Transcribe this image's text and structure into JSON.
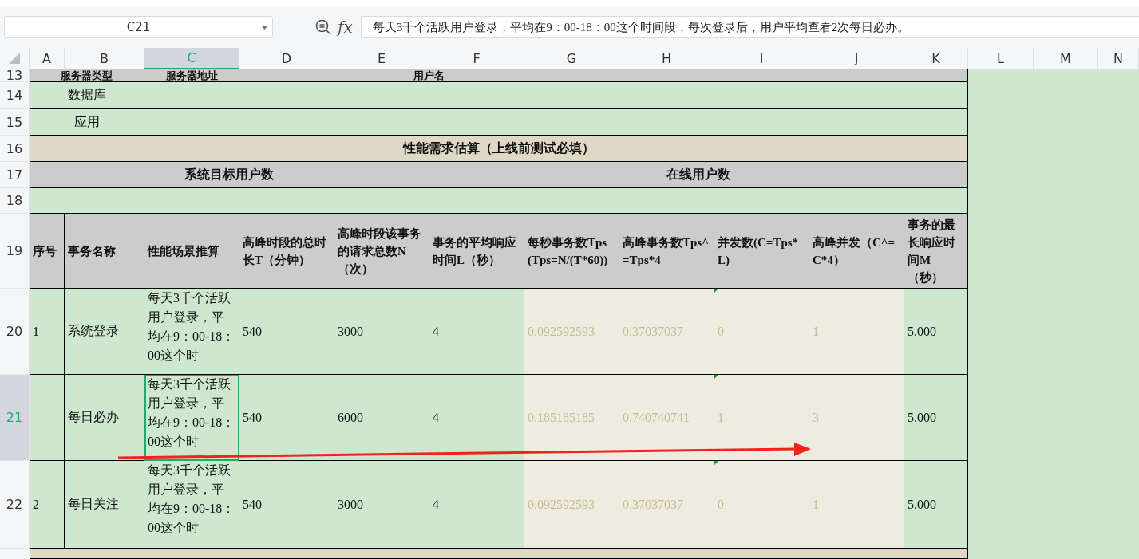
{
  "formula_bar": {
    "name_box": "C21",
    "function_label": "fx",
    "formula": "每天3千个活跃用户登录，平均在9：00-18：00这个时间段，每次登录后，用户平均查看2次每日必办。"
  },
  "column_headers": [
    {
      "label": "A",
      "selected": false
    },
    {
      "label": "B",
      "selected": false
    },
    {
      "label": "C",
      "selected": true
    },
    {
      "label": "D",
      "selected": false
    },
    {
      "label": "E",
      "selected": false
    },
    {
      "label": "F",
      "selected": false
    },
    {
      "label": "G",
      "selected": false
    },
    {
      "label": "H",
      "selected": false
    },
    {
      "label": "I",
      "selected": false
    },
    {
      "label": "J",
      "selected": false
    },
    {
      "label": "K",
      "selected": false
    },
    {
      "label": "L",
      "selected": false
    },
    {
      "label": "M",
      "selected": false
    },
    {
      "label": "N",
      "selected": false
    }
  ],
  "rows": [
    {
      "number": "13",
      "selected": false,
      "kind": "server_header",
      "cells": [
        "服务器类型",
        "服务器地址",
        "用户名"
      ]
    },
    {
      "number": "14",
      "selected": false,
      "kind": "server",
      "cells": [
        "数据库"
      ]
    },
    {
      "number": "15",
      "selected": false,
      "kind": "server",
      "cells": [
        "应用"
      ]
    },
    {
      "number": "16",
      "selected": false,
      "kind": "section",
      "cells": [
        "性能需求估算（上线前测试必填）"
      ]
    },
    {
      "number": "17",
      "selected": false,
      "kind": "group_header",
      "cells": [
        "系统目标用户数",
        "在线用户数"
      ]
    },
    {
      "number": "18",
      "selected": false,
      "kind": "blank",
      "cells": []
    },
    {
      "number": "19",
      "selected": false,
      "kind": "column_titles",
      "cells": [
        "序号",
        "事务名称",
        "性能场景推算",
        "高峰时段的总时长T（分钟）",
        "高峰时段该事务的请求总数N（次）",
        "事务的平均响应时间L（秒）",
        "每秒事务数Tps(Tps=N/(T*60))",
        "高峰事务数Tps^=Tps*4",
        "并发数(C=Tps*L)",
        "高峰并发（C^=C*4）",
        "事务的最长响应时间M（秒）"
      ]
    },
    {
      "number": "20",
      "selected": false,
      "kind": "record",
      "cells": [
        {
          "text": "1",
          "computed": false,
          "flagged": false
        },
        {
          "text": "系统登录",
          "computed": false,
          "flagged": false
        },
        {
          "text": "每天3千个活跃用户登录，平均在9：00-18：00这个时",
          "computed": false,
          "flagged": false
        },
        {
          "text": "540",
          "computed": false,
          "flagged": false
        },
        {
          "text": "3000",
          "computed": false,
          "flagged": false
        },
        {
          "text": "4",
          "computed": false,
          "flagged": false
        },
        {
          "text": "0.092592593",
          "computed": true,
          "flagged": false
        },
        {
          "text": "0.37037037",
          "computed": true,
          "flagged": false
        },
        {
          "text": "0",
          "computed": true,
          "flagged": true
        },
        {
          "text": "1",
          "computed": true,
          "flagged": false
        },
        {
          "text": "5.000",
          "computed": false,
          "flagged": false
        }
      ]
    },
    {
      "number": "21",
      "selected": true,
      "kind": "record",
      "cells": [
        {
          "computed": false,
          "flagged": false
        },
        {
          "text": "每日必办",
          "computed": false,
          "flagged": false
        },
        {
          "text": "每天3千个活跃用户登录，平均在9：00-18：00这个时",
          "computed": false,
          "flagged": false
        },
        {
          "text": "540",
          "computed": false,
          "flagged": false
        },
        {
          "text": "6000",
          "computed": false,
          "flagged": false
        },
        {
          "text": "4",
          "computed": false,
          "flagged": false
        },
        {
          "text": "0.185185185",
          "computed": true,
          "flagged": false
        },
        {
          "text": "0.740740741",
          "computed": true,
          "flagged": false
        },
        {
          "text": "1",
          "computed": true,
          "flagged": true
        },
        {
          "text": "3",
          "computed": true,
          "flagged": false
        },
        {
          "text": "5.000",
          "computed": false,
          "flagged": false
        }
      ]
    },
    {
      "number": "22",
      "selected": false,
      "kind": "record",
      "cells": [
        {
          "text": "2",
          "computed": false,
          "flagged": false
        },
        {
          "text": "每日关注",
          "computed": false,
          "flagged": false
        },
        {
          "text": "每天3千个活跃用户登录，平均在9：00-18：00这个时",
          "computed": false,
          "flagged": false
        },
        {
          "text": "540",
          "computed": false,
          "flagged": false
        },
        {
          "text": "3000",
          "computed": false,
          "flagged": false
        },
        {
          "text": "4",
          "computed": false,
          "flagged": false
        },
        {
          "text": "0.092592593",
          "computed": true,
          "flagged": false
        },
        {
          "text": "0.37037037",
          "computed": true,
          "flagged": false
        },
        {
          "text": "0",
          "computed": true,
          "flagged": true
        },
        {
          "text": "1",
          "computed": true,
          "flagged": false
        },
        {
          "text": "5.000",
          "computed": false,
          "flagged": false
        }
      ]
    },
    {
      "kind": "section_cut",
      "cells": []
    }
  ]
}
